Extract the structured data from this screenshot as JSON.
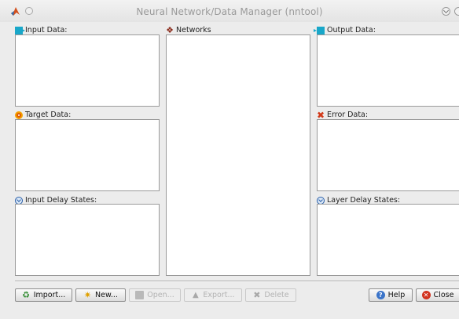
{
  "window": {
    "title": "Neural Network/Data Manager (nntool)"
  },
  "panels": {
    "input_data": {
      "label": "Input Data:",
      "icon": "input-data-icon",
      "items": []
    },
    "target_data": {
      "label": "Target Data:",
      "icon": "target-icon",
      "items": []
    },
    "input_delay_states": {
      "label": "Input Delay States:",
      "icon": "delay-icon",
      "items": []
    },
    "networks": {
      "label": "Networks",
      "icon": "network-icon",
      "items": []
    },
    "output_data": {
      "label": "Output Data:",
      "icon": "output-data-icon",
      "items": []
    },
    "error_data": {
      "label": "Error Data:",
      "icon": "error-icon",
      "items": []
    },
    "layer_delay_states": {
      "label": "Layer Delay States:",
      "icon": "delay-icon",
      "items": []
    }
  },
  "buttons": {
    "import": {
      "label": "Import...",
      "icon": "import-icon",
      "enabled": true
    },
    "new": {
      "label": "New...",
      "icon": "new-icon",
      "enabled": true
    },
    "open": {
      "label": "Open...",
      "icon": "open-icon",
      "enabled": false
    },
    "export": {
      "label": "Export...",
      "icon": "export-icon",
      "enabled": false
    },
    "delete": {
      "label": "Delete",
      "icon": "delete-icon",
      "enabled": false
    },
    "help": {
      "label": "Help",
      "icon": "help-icon",
      "enabled": true
    },
    "close": {
      "label": "Close",
      "icon": "close-icon",
      "enabled": true
    }
  },
  "colors": {
    "window_bg": "#ececec",
    "listbox_bg": "#ffffff",
    "title_text": "#9a9a9a",
    "disabled_text": "#b3b3b3"
  }
}
